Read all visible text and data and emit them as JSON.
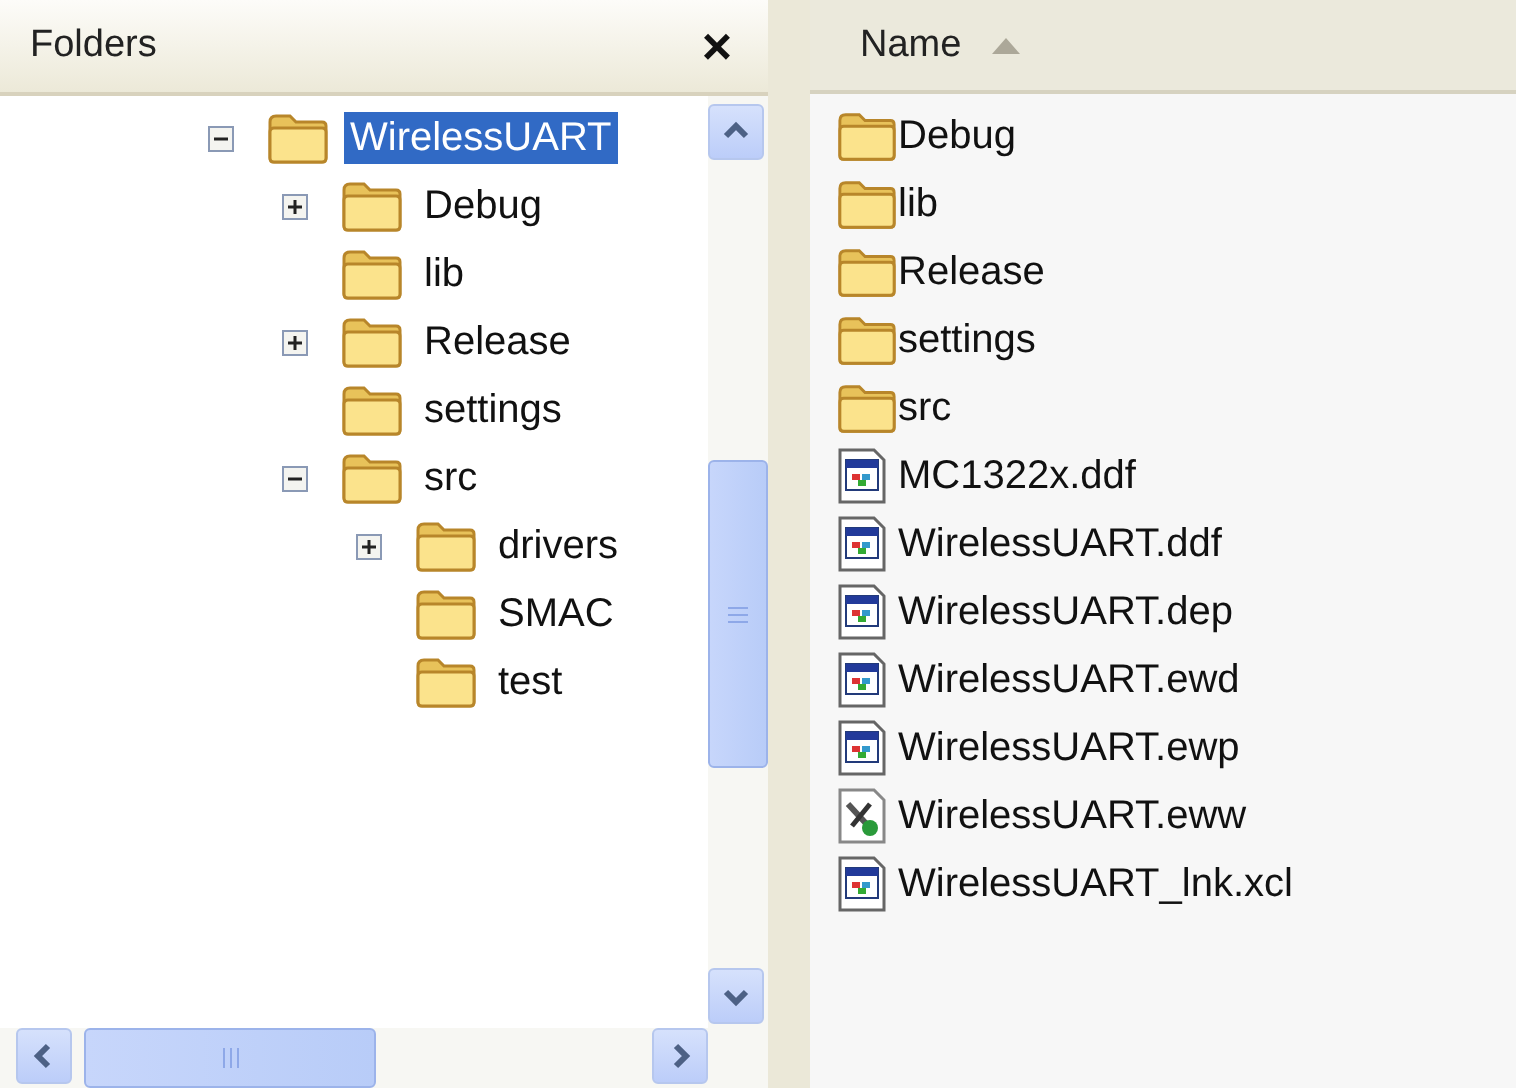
{
  "folders_pane": {
    "title": "Folders",
    "close": "×",
    "tree": [
      {
        "label": "WirelessUART",
        "expanded": true,
        "selected": true,
        "children": [
          {
            "label": "Debug",
            "expanded": false,
            "selected": false
          },
          {
            "label": "lib",
            "selected": false
          },
          {
            "label": "Release",
            "expanded": false,
            "selected": false
          },
          {
            "label": "settings",
            "selected": false
          },
          {
            "label": "src",
            "expanded": true,
            "selected": false,
            "children": [
              {
                "label": "drivers",
                "expanded": false,
                "selected": false
              },
              {
                "label": "SMAC",
                "selected": false
              },
              {
                "label": "test",
                "selected": false
              }
            ]
          }
        ]
      }
    ]
  },
  "file_list": {
    "columns": [
      {
        "label": "Name",
        "sorted": true
      }
    ],
    "items": [
      {
        "name": "Debug",
        "kind": "folder"
      },
      {
        "name": "lib",
        "kind": "folder"
      },
      {
        "name": "Release",
        "kind": "folder"
      },
      {
        "name": "settings",
        "kind": "folder"
      },
      {
        "name": "src",
        "kind": "folder"
      },
      {
        "name": "MC1322x.ddf",
        "kind": "document"
      },
      {
        "name": "WirelessUART.ddf",
        "kind": "document"
      },
      {
        "name": "WirelessUART.dep",
        "kind": "document"
      },
      {
        "name": "WirelessUART.ewd",
        "kind": "document"
      },
      {
        "name": "WirelessUART.ewp",
        "kind": "document"
      },
      {
        "name": "WirelessUART.eww",
        "kind": "workspace"
      },
      {
        "name": "WirelessUART_lnk.xcl",
        "kind": "document"
      }
    ]
  }
}
